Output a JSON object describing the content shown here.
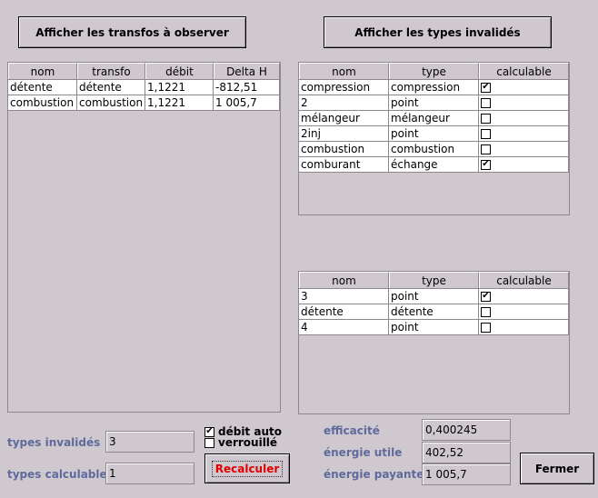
{
  "buttons": {
    "show_transfos": "Afficher les transfos à observer",
    "show_invalid_types": "Afficher les types invalidés",
    "recalc": "Recalculer",
    "close": "Fermer"
  },
  "transfo_table": {
    "headers": [
      "nom",
      "transfo",
      "débit",
      "Delta H"
    ],
    "rows": [
      [
        "détente",
        "détente",
        "1,1221",
        "-812,51"
      ],
      [
        "combustion",
        "combustion",
        "1,1221",
        "1 005,7"
      ]
    ]
  },
  "invalid_table": {
    "headers": [
      "nom",
      "type",
      "calculable"
    ],
    "rows": [
      {
        "nom": "compression",
        "type": "compression",
        "checked": true
      },
      {
        "nom": "2",
        "type": "point",
        "checked": false
      },
      {
        "nom": "mélangeur",
        "type": "mélangeur",
        "checked": false
      },
      {
        "nom": "2inj",
        "type": "point",
        "checked": false
      },
      {
        "nom": "combustion",
        "type": "combustion",
        "checked": false
      },
      {
        "nom": "comburant",
        "type": "échange",
        "checked": true
      }
    ]
  },
  "calc_table": {
    "headers": [
      "nom",
      "type",
      "calculable"
    ],
    "rows": [
      {
        "nom": "3",
        "type": "point",
        "checked": true
      },
      {
        "nom": "détente",
        "type": "détente",
        "checked": false
      },
      {
        "nom": "4",
        "type": "point",
        "checked": false
      }
    ]
  },
  "bottom": {
    "types_invalides_label": "types invalidés",
    "types_invalides_value": "3",
    "types_calculables_label": "types calculables",
    "types_calculables_value": "1",
    "debit_auto_label": "débit auto",
    "debit_auto_checked": true,
    "verrouille_label": "verrouillé",
    "verrouille_checked": false,
    "efficacite_label": "efficacité",
    "efficacite_value": "0,400245",
    "energie_utile_label": "énergie utile",
    "energie_utile_value": "402,52",
    "energie_payante_label": "énergie payante",
    "energie_payante_value": "1 005,7"
  },
  "colors": {
    "background": "#cfc8cf",
    "label_blue": "#5e6a9c",
    "recalc_red": "#e00000"
  }
}
